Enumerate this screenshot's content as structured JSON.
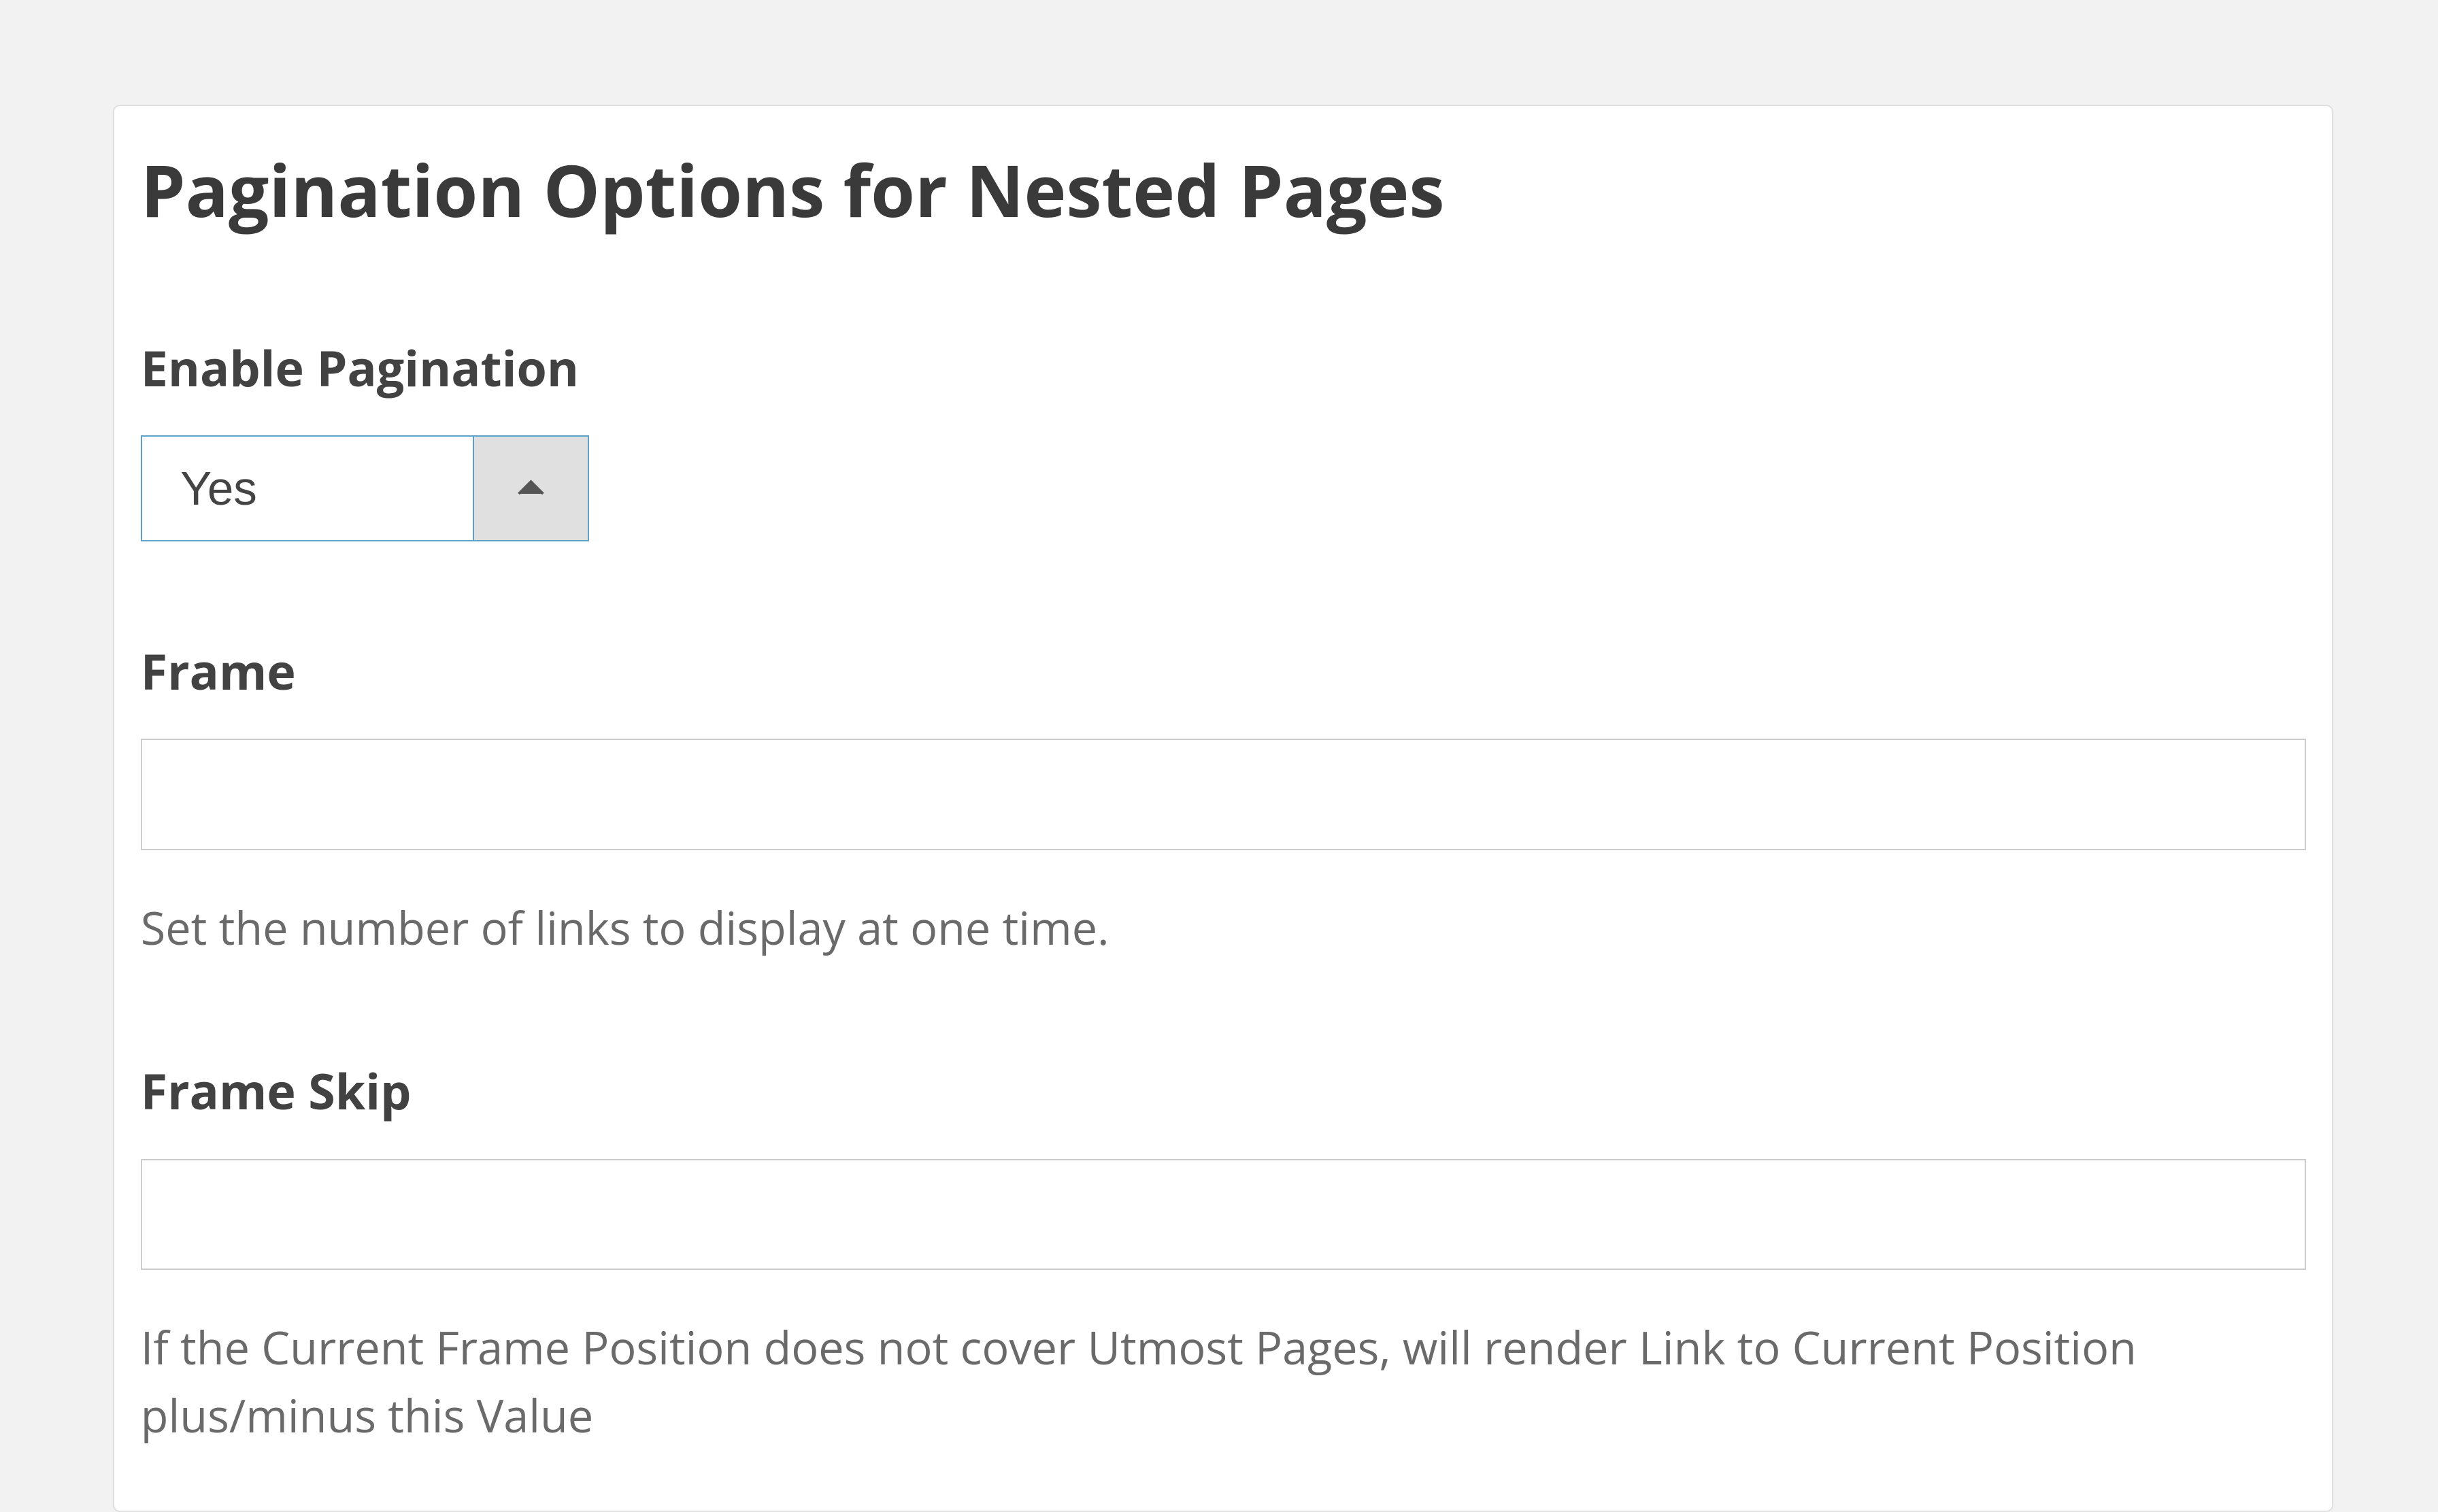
{
  "panel": {
    "title": "Pagination Options for Nested Pages",
    "fields": {
      "enable_pagination": {
        "label": "Enable Pagination",
        "value": "Yes"
      },
      "frame": {
        "label": "Frame",
        "value": "",
        "help": "Set the number of links to display at one time."
      },
      "frame_skip": {
        "label": "Frame Skip",
        "value": "",
        "help": "If the Current Frame Position does not cover Utmost Pages, will render Link to Current Position plus/minus this Value"
      }
    }
  }
}
